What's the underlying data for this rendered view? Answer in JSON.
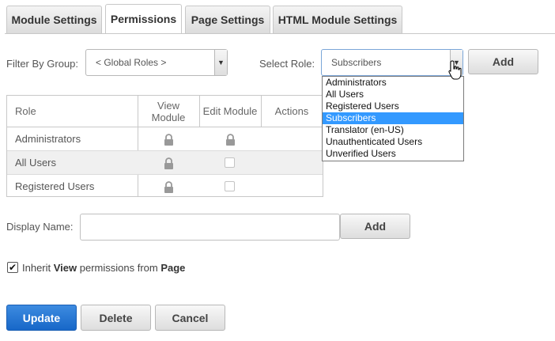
{
  "tabs": [
    {
      "label": "Module Settings"
    },
    {
      "label": "Permissions"
    },
    {
      "label": "Page Settings"
    },
    {
      "label": "HTML Module Settings"
    }
  ],
  "filter": {
    "label": "Filter By Group:",
    "value": "< Global Roles >"
  },
  "role_select": {
    "label": "Select Role:",
    "value": "Subscribers",
    "add_label": "Add",
    "options": [
      "Administrators",
      "All Users",
      "Registered Users",
      "Subscribers",
      "Translator (en-US)",
      "Unauthenticated Users",
      "Unverified Users"
    ]
  },
  "grid": {
    "headers": {
      "role": "Role",
      "view_line1": "View",
      "view_line2": "Module",
      "edit": "Edit Module",
      "actions": "Actions"
    },
    "rows": [
      {
        "role": "Administrators",
        "view": "locked",
        "edit": "locked"
      },
      {
        "role": "All Users",
        "view": "locked",
        "edit": "unchecked"
      },
      {
        "role": "Registered Users",
        "view": "locked",
        "edit": "unchecked"
      }
    ]
  },
  "display_name": {
    "label": "Display Name:",
    "value": "",
    "add_label": "Add"
  },
  "inherit": {
    "prefix": "Inherit ",
    "view": "View",
    "middle": " permissions from ",
    "page": "Page",
    "checked": true
  },
  "actions": {
    "update": "Update",
    "delete": "Delete",
    "cancel": "Cancel"
  },
  "colors": {
    "primary": "#1767c8",
    "selection": "#3399ff"
  }
}
